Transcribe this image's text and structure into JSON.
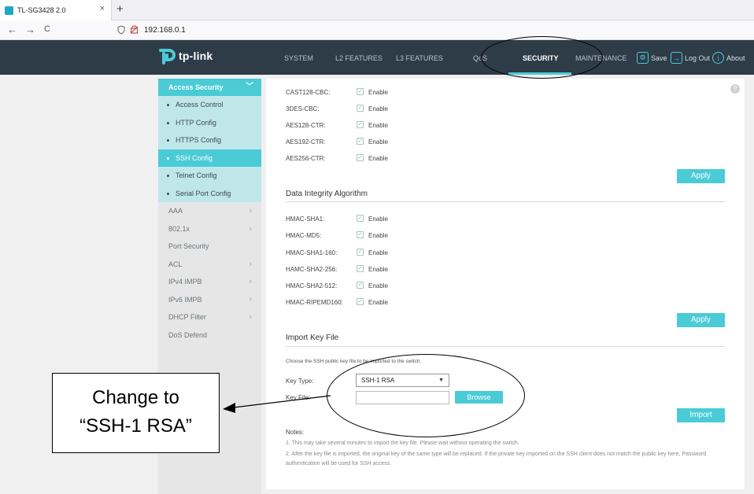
{
  "browser": {
    "tab_title": "TL-SG3428 2.0",
    "tab_close": "×",
    "new_tab": "+",
    "back": "←",
    "forward": "→",
    "reload": "C",
    "url": "192.168.0.1"
  },
  "header": {
    "logo_text": "tp-link",
    "menu": [
      "SYSTEM",
      "L2 FEATURES",
      "L3 FEATURES",
      "QoS",
      "SECURITY",
      "MAINTENANCE"
    ],
    "active_menu": "SECURITY",
    "save": "Save",
    "logout": "Log Out",
    "about": "About",
    "accent_color": "#4acbd6"
  },
  "sidebar": {
    "group": "Access Security",
    "sub_items": [
      "Access Control",
      "HTTP Config",
      "HTTPS Config",
      "SSH Config",
      "Telnet Config",
      "Serial Port Config"
    ],
    "active_sub": "SSH Config",
    "items": [
      {
        "label": "AAA",
        "has_chevron": true
      },
      {
        "label": "802.1x",
        "has_chevron": true
      },
      {
        "label": "Port Security",
        "has_chevron": false
      },
      {
        "label": "ACL",
        "has_chevron": true
      },
      {
        "label": "IPv4 IMPB",
        "has_chevron": true
      },
      {
        "label": "IPv6 IMPB",
        "has_chevron": true
      },
      {
        "label": "DHCP Filter",
        "has_chevron": true
      },
      {
        "label": "DoS Defend",
        "has_chevron": false
      }
    ]
  },
  "encryption": {
    "rows": [
      {
        "label": "CAST128-CBC:",
        "checked": true,
        "enable": "Enable"
      },
      {
        "label": "3DES-CBC:",
        "checked": true,
        "enable": "Enable"
      },
      {
        "label": "AES128-CTR:",
        "checked": true,
        "enable": "Enable"
      },
      {
        "label": "AES192-CTR:",
        "checked": true,
        "enable": "Enable"
      },
      {
        "label": "AES256-CTR:",
        "checked": true,
        "enable": "Enable"
      }
    ],
    "apply": "Apply"
  },
  "integrity": {
    "title": "Data Integrity Algorithm",
    "rows": [
      {
        "label": "HMAC-SHA1:",
        "checked": true,
        "enable": "Enable"
      },
      {
        "label": "HMAC-MD5:",
        "checked": true,
        "enable": "Enable"
      },
      {
        "label": "HMAC-SHA1-160:",
        "checked": true,
        "enable": "Enable"
      },
      {
        "label": "HAMC-SHA2-256:",
        "checked": true,
        "enable": "Enable"
      },
      {
        "label": "HMAC-SHA2-512:",
        "checked": true,
        "enable": "Enable"
      },
      {
        "label": "HMAC-RIPEMD160:",
        "checked": true,
        "enable": "Enable"
      }
    ],
    "apply": "Apply"
  },
  "import_key": {
    "title": "Import Key File",
    "description": "Choose the SSH public key file to be imported to the switch.",
    "key_type_label": "Key Type:",
    "key_type_value": "SSH-1 RSA",
    "key_file_label": "Key File:",
    "key_file_value": "",
    "browse": "Browse",
    "import": "Import"
  },
  "notes": {
    "title": "Notes:",
    "items": [
      "1. This may take several minutes to import the key file. Please wait without operating the switch.",
      "2. After the key file is imported, the original key of the same type will be replaced. If the private key imported on the SSH client does not match the public key here, Password authentication will be used for SSH access."
    ]
  },
  "annotation": {
    "line1": "Change to",
    "line2": "“SSH-1 RSA”"
  }
}
